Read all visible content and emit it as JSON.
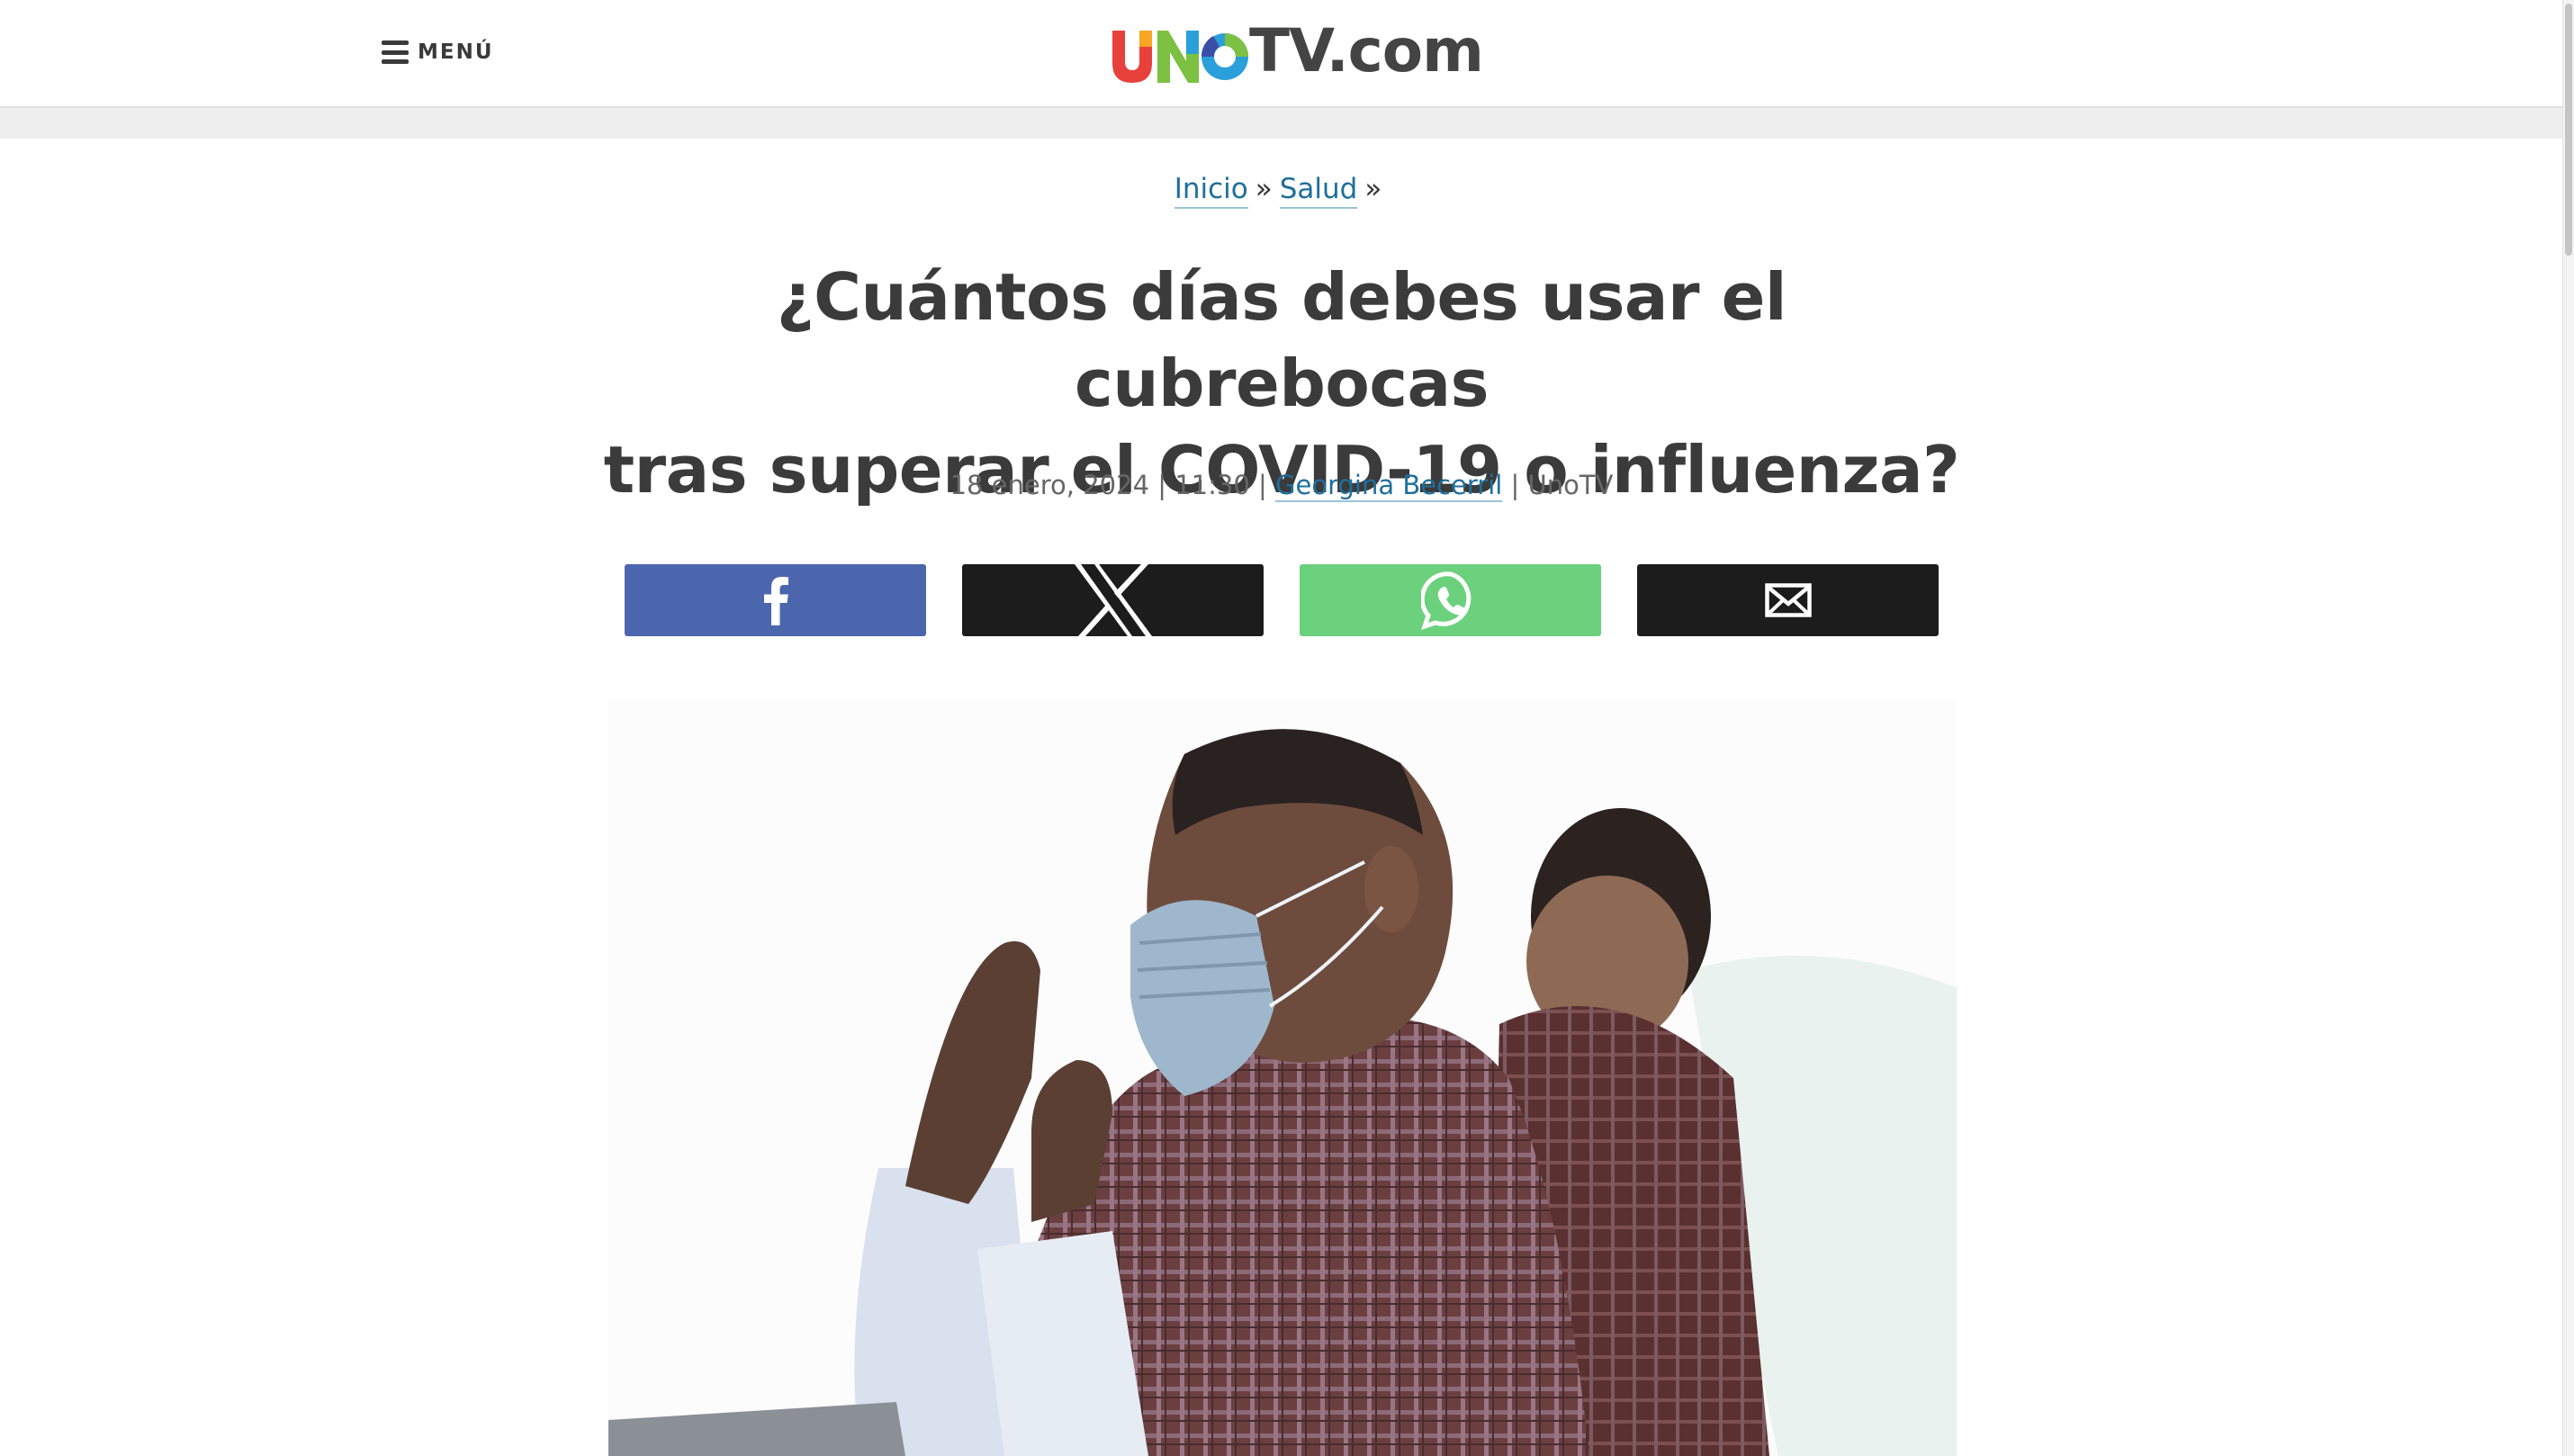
{
  "header": {
    "menu_label": "MENÚ",
    "logo_text": "TV.com",
    "logo_colors": [
      "#e8413c",
      "#f6a623",
      "#7cc142",
      "#2b9fd9",
      "#3b4fa8"
    ]
  },
  "breadcrumb": {
    "items": [
      "Inicio",
      "Salud"
    ],
    "separator": "»"
  },
  "article": {
    "title_line1": "¿Cuántos días debes usar el cubrebocas",
    "title_line2": "tras superar el COVID-19 o influenza?",
    "date": "18 enero, 2024",
    "time": "11:30",
    "author": "Georgina Becerril",
    "source": "UnoTV",
    "meta_sep": "|"
  },
  "share": {
    "buttons": [
      {
        "network": "facebook",
        "icon": "facebook-icon",
        "color": "#4b66ad"
      },
      {
        "network": "x",
        "icon": "x-icon",
        "color": "#1c1c1c"
      },
      {
        "network": "whatsapp",
        "icon": "whatsapp-icon",
        "color": "#6bd17c"
      },
      {
        "network": "email",
        "icon": "mail-icon",
        "color": "#1c1c1c"
      }
    ]
  },
  "hero": {
    "subject": "photo"
  }
}
